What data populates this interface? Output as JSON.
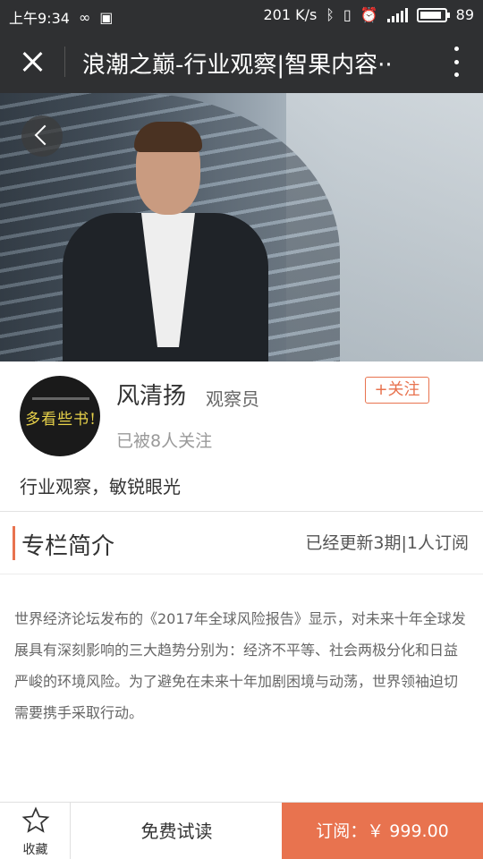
{
  "statusbar": {
    "time": "上午9:34",
    "speed": "201 K/s",
    "network": "4G",
    "battery": "89",
    "battery_level": 0.89
  },
  "titlebar": {
    "title": "浪潮之巅-行业观察|智果内容··"
  },
  "profile": {
    "name": "风清扬",
    "role": "观察员",
    "follow_label": "+关注",
    "followers": "已被8人关注",
    "slogan": "行业观察，敏锐眼光",
    "avatar_text": "多看些书!"
  },
  "section": {
    "title": "专栏简介",
    "meta": "已经更新3期|1人订阅"
  },
  "intro": "世界经济论坛发布的《2017年全球风险报告》显示，对未来十年全球发展具有深刻影响的三大趋势分别为：经济不平等、社会两极分化和日益严峻的环境风险。为了避免在未来十年加剧困境与动荡，世界领袖迫切需要携手采取行动。",
  "bottombar": {
    "fav_label": "收藏",
    "trial_label": "免费试读",
    "subscribe_label": "订阅：￥ 999.00"
  },
  "colors": {
    "accent": "#e8734f",
    "header": "#2f3032"
  }
}
